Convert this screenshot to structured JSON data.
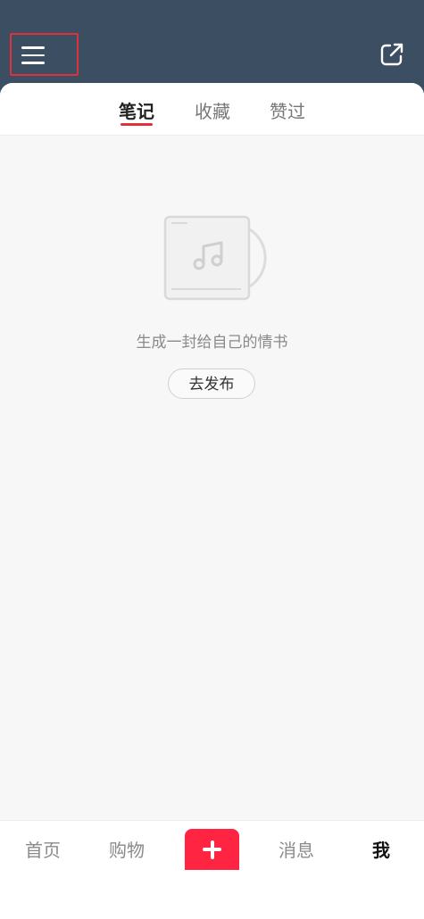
{
  "header": {
    "menu_icon": "hamburger-menu-icon",
    "share_icon": "share-external-icon",
    "background_color": "#3b4e62",
    "highlight_color": "#e0303b"
  },
  "tabs": [
    {
      "label": "笔记",
      "active": true
    },
    {
      "label": "收藏",
      "active": false
    },
    {
      "label": "赞过",
      "active": false
    }
  ],
  "empty_state": {
    "illustration": "music-album-icon",
    "message": "生成一封给自己的情书",
    "publish_label": "去发布"
  },
  "bottom_nav": {
    "items": [
      {
        "label": "首页",
        "active": false
      },
      {
        "label": "购物",
        "active": false
      },
      {
        "label": "消息",
        "active": false
      },
      {
        "label": "我",
        "active": true
      }
    ],
    "add_icon": "plus-icon",
    "add_color": "#ff2442"
  }
}
